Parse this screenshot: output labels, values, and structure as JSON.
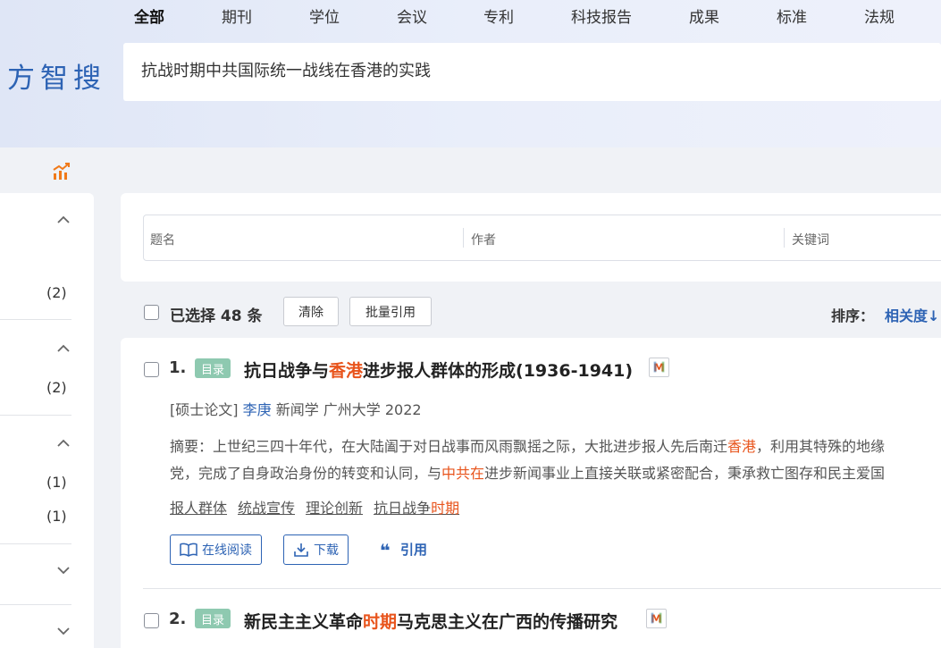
{
  "nav": {
    "items": [
      "全部",
      "期刊",
      "学位",
      "会议",
      "专利",
      "科技报告",
      "成果",
      "标准",
      "法规"
    ],
    "active": "全部"
  },
  "logo": {
    "text": "方智搜"
  },
  "search": {
    "value": "抗战时期中共国际统一战线在香港的实践"
  },
  "sidebar": {
    "counts": [
      "(2)",
      "(2)",
      "(1)",
      "(1)"
    ]
  },
  "filter": {
    "fields": [
      "题名",
      "作者",
      "关键词"
    ]
  },
  "toolbar": {
    "selected": "已选择 48 条",
    "clear_label": "清除",
    "batch_cite_label": "批量引用",
    "sort_label": "排序：",
    "sort_value": "相关度↓"
  },
  "results": [
    {
      "num": "1.",
      "tag": "目录",
      "title_parts": [
        {
          "t": "抗日战争与",
          "hl": false
        },
        {
          "t": "香港",
          "hl": true
        },
        {
          "t": "进步报人群体的形成(1936-1941)",
          "hl": false
        }
      ],
      "meta": {
        "type": "[硕士论文]",
        "author": "李庚",
        "rest": "新闻学 广州大学 2022"
      },
      "abstract_line1": [
        {
          "t": "摘要：上世纪三四十年代，在大陆阖于对日战事而风雨飘摇之际，大批进步报人先后南迁",
          "hl": false
        },
        {
          "t": "香港",
          "hl": true
        },
        {
          "t": "，利用其特殊的地缘",
          "hl": false
        }
      ],
      "abstract_line2": [
        {
          "t": "党，完成了自身政治身份的转变和认同，与",
          "hl": false
        },
        {
          "t": "中共在",
          "hl": true
        },
        {
          "t": "进步新闻事业上直接关联或紧密配合，秉承救亡图存和民主爱国",
          "hl": false
        }
      ],
      "keywords": [
        [
          {
            "t": "报人群体",
            "hl": false
          }
        ],
        [
          {
            "t": "统战宣传",
            "hl": false
          }
        ],
        [
          {
            "t": "理论创新",
            "hl": false
          }
        ],
        [
          {
            "t": "抗日战争",
            "hl": false
          },
          {
            "t": "时期",
            "hl": true
          }
        ]
      ],
      "actions": {
        "read": "在线阅读",
        "download": "下载",
        "cite": "引用"
      }
    },
    {
      "num": "2.",
      "tag": "目录",
      "title_parts": [
        {
          "t": "新民主主义革命",
          "hl": false
        },
        {
          "t": "时期",
          "hl": true
        },
        {
          "t": "马克思主义在广西的传播研究",
          "hl": false
        }
      ]
    }
  ],
  "colors": {
    "accent": "#2d63b4",
    "highlight": "#e8541c",
    "tag": "#8ec9b0"
  }
}
